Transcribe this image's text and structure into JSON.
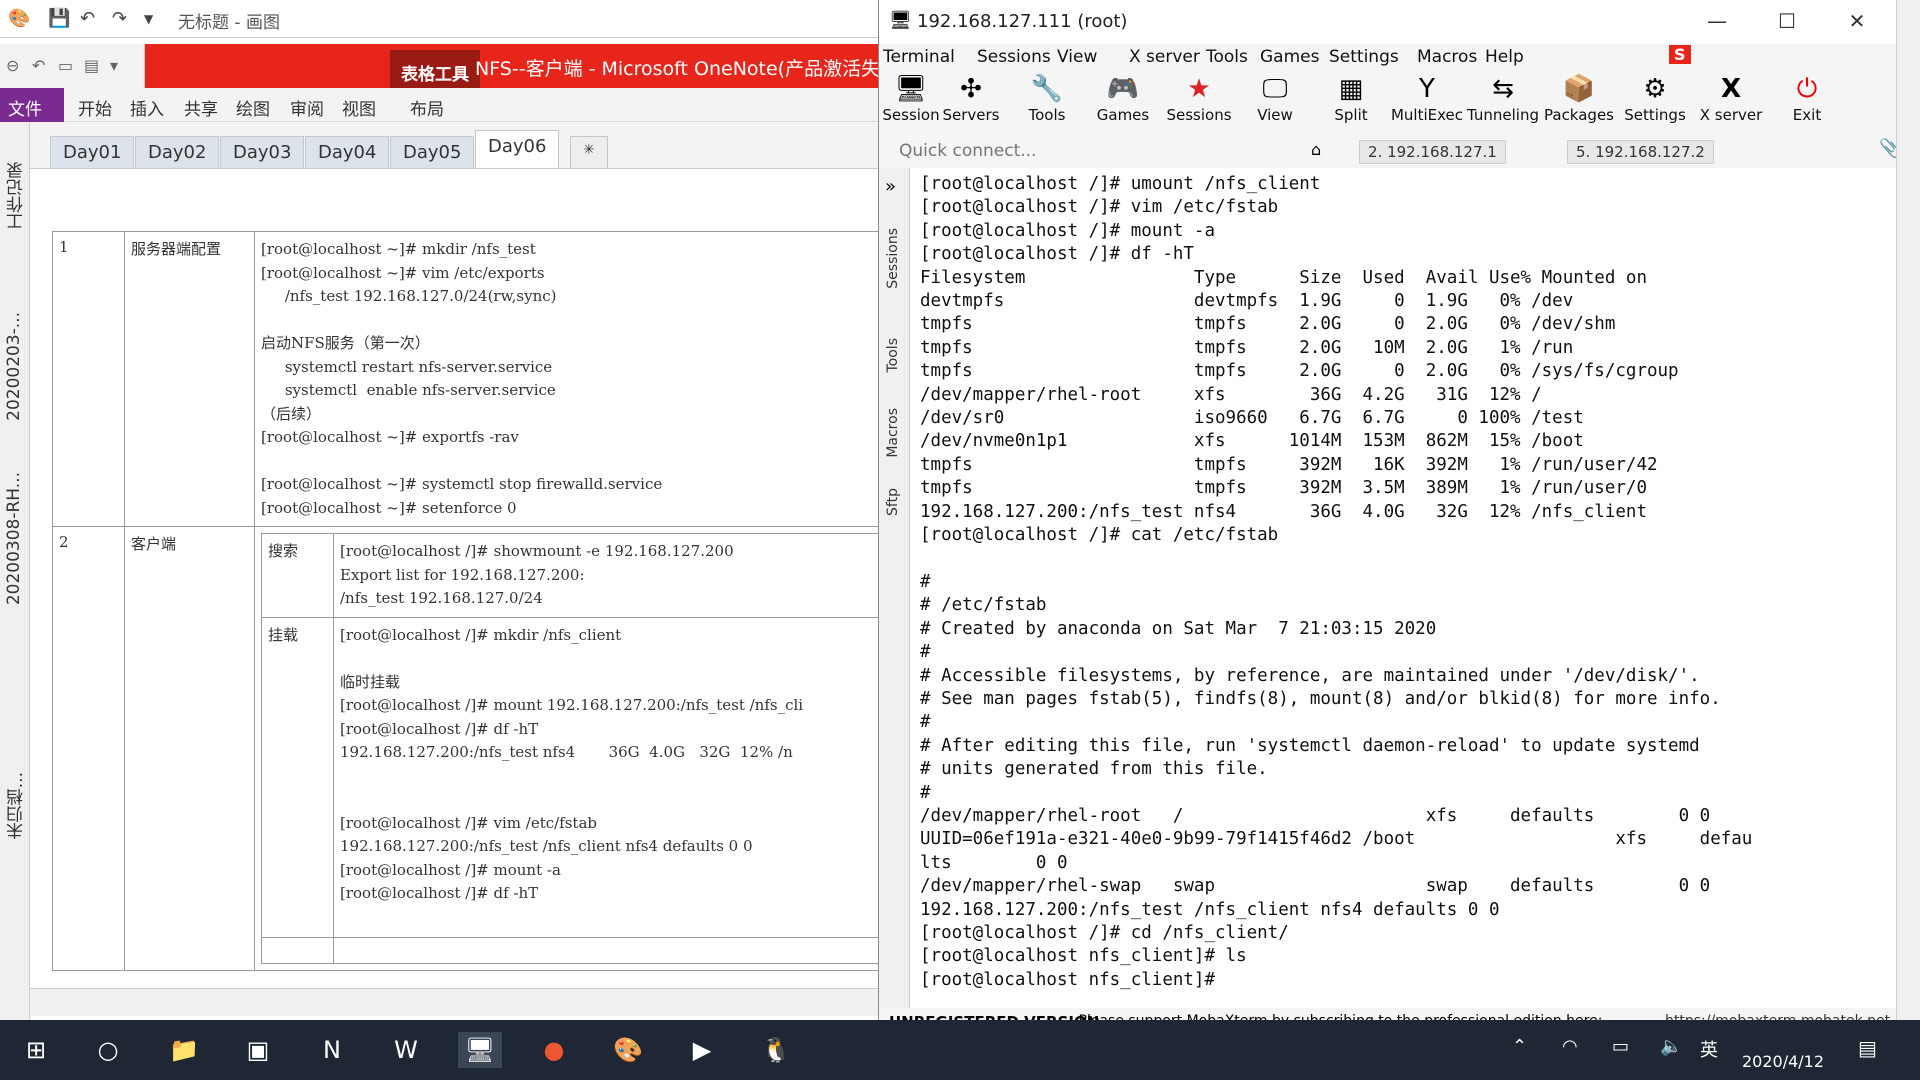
{
  "paint": {
    "title": "无标题 - 画图"
  },
  "onenote": {
    "table_tools": "表格工具",
    "title": "NFS--客户端 - Microsoft OneNote(产品激活失败",
    "ribbon_tabs": [
      "文件",
      "开始",
      "插入",
      "共享",
      "绘图",
      "审阅",
      "视图",
      "布局"
    ],
    "section_tabs": [
      "Day01",
      "Day02",
      "Day03",
      "Day04",
      "Day05",
      "Day06"
    ],
    "side_labels": [
      "工作记录",
      "20200203-...",
      "20200308-RH...",
      "未归档..."
    ],
    "rows": [
      {
        "num": "1",
        "label": "服务器端配置",
        "code": "[root@localhost ~]# mkdir /nfs_test\n[root@localhost ~]# vim /etc/exports\n     /nfs_test 192.168.127.0/24(rw,sync)\n\n启动NFS服务（第一次）\n     systemctl restart nfs-server.service\n     systemctl  enable nfs-server.service\n（后续）\n[root@localhost ~]# exportfs -rav\n\n[root@localhost ~]# systemctl stop firewalld.service\n[root@localhost ~]# setenforce 0"
      },
      {
        "num": "2",
        "label": "客户端",
        "sub": [
          {
            "label": "搜索",
            "code": "[root@localhost /]# showmount -e 192.168.127.200\nExport list for 192.168.127.200:\n/nfs_test 192.168.127.0/24"
          },
          {
            "label": "挂载",
            "code": "[root@localhost /]# mkdir /nfs_client\n\n临时挂载\n[root@localhost /]# mount 192.168.127.200:/nfs_test /nfs_cli\n[root@localhost /]# df -hT\n192.168.127.200:/nfs_test nfs4       36G  4.0G   32G  12% /n\n\n\n[root@localhost /]# vim /etc/fstab\n192.168.127.200:/nfs_test /nfs_client nfs4 defaults 0 0\n[root@localhost /]# mount -a\n[root@localhost /]# df -hT"
          }
        ]
      }
    ]
  },
  "moba": {
    "title": "192.168.127.111 (root)",
    "menu": [
      "Terminal",
      "Sessions",
      "View",
      "X server",
      "Tools",
      "Games",
      "Settings",
      "Macros",
      "Help"
    ],
    "toolbar": [
      {
        "label": "Session",
        "icon": "session-icon"
      },
      {
        "label": "Servers",
        "icon": "servers-icon"
      },
      {
        "label": "Tools",
        "icon": "tools-icon"
      },
      {
        "label": "Games",
        "icon": "games-icon"
      },
      {
        "label": "Sessions",
        "icon": "sessions-icon"
      },
      {
        "label": "View",
        "icon": "view-icon"
      },
      {
        "label": "Split",
        "icon": "split-icon"
      },
      {
        "label": "MultiExec",
        "icon": "multiexec-icon"
      },
      {
        "label": "Tunneling",
        "icon": "tunneling-icon"
      },
      {
        "label": "Packages",
        "icon": "packages-icon"
      },
      {
        "label": "Settings",
        "icon": "settings-icon"
      },
      {
        "label": "X server",
        "icon": "xserver-icon"
      },
      {
        "label": "Exit",
        "icon": "exit-icon"
      }
    ],
    "quick_connect_placeholder": "Quick connect...",
    "session_tabs": [
      "2. 192.168.127.1",
      "5. 192.168.127.2"
    ],
    "side_tabs": [
      "Sessions",
      "Tools",
      "Macros",
      "Sftp"
    ],
    "terminal": "[root@localhost /]# umount /nfs_client\n[root@localhost /]# vim /etc/fstab\n[root@localhost /]# mount -a\n[root@localhost /]# df -hT\nFilesystem                Type      Size  Used  Avail Use% Mounted on\ndevtmpfs                  devtmpfs  1.9G     0  1.9G   0% /dev\ntmpfs                     tmpfs     2.0G     0  2.0G   0% /dev/shm\ntmpfs                     tmpfs     2.0G   10M  2.0G   1% /run\ntmpfs                     tmpfs     2.0G     0  2.0G   0% /sys/fs/cgroup\n/dev/mapper/rhel-root     xfs        36G  4.2G   31G  12% /\n/dev/sr0                  iso9660   6.7G  6.7G     0 100% /test\n/dev/nvme0n1p1            xfs      1014M  153M  862M  15% /boot\ntmpfs                     tmpfs     392M   16K  392M   1% /run/user/42\ntmpfs                     tmpfs     392M  3.5M  389M   1% /run/user/0\n192.168.127.200:/nfs_test nfs4       36G  4.0G   32G  12% /nfs_client\n[root@localhost /]# cat /etc/fstab\n\n#\n# /etc/fstab\n# Created by anaconda on Sat Mar  7 21:03:15 2020\n#\n# Accessible filesystems, by reference, are maintained under '/dev/disk/'.\n# See man pages fstab(5), findfs(8), mount(8) and/or blkid(8) for more info.\n#\n# After editing this file, run 'systemctl daemon-reload' to update systemd\n# units generated from this file.\n#\n/dev/mapper/rhel-root   /                       xfs     defaults        0 0\nUUID=06ef191a-e321-40e0-9b99-79f1415f46d2 /boot                   xfs     defau\nlts        0 0\n/dev/mapper/rhel-swap   swap                    swap    defaults        0 0\n192.168.127.200:/nfs_test /nfs_client nfs4 defaults 0 0\n[root@localhost /]# cd /nfs_client/\n[root@localhost nfs_client]# ls\n[root@localhost nfs_client]# ",
    "status_bold": "UNREGISTERED VERSION",
    "status_text": " -  Please support MobaXterm by subscribing to the professional edition here:",
    "status_link": "https://mobaxterm.mobatek.net"
  },
  "taskbar": {
    "ime": "英",
    "date": "2020/4/12"
  },
  "colors": {
    "onenote_red": "#e8251b",
    "onenote_purple": "#7a2b91",
    "taskbar": "#1e2733"
  }
}
